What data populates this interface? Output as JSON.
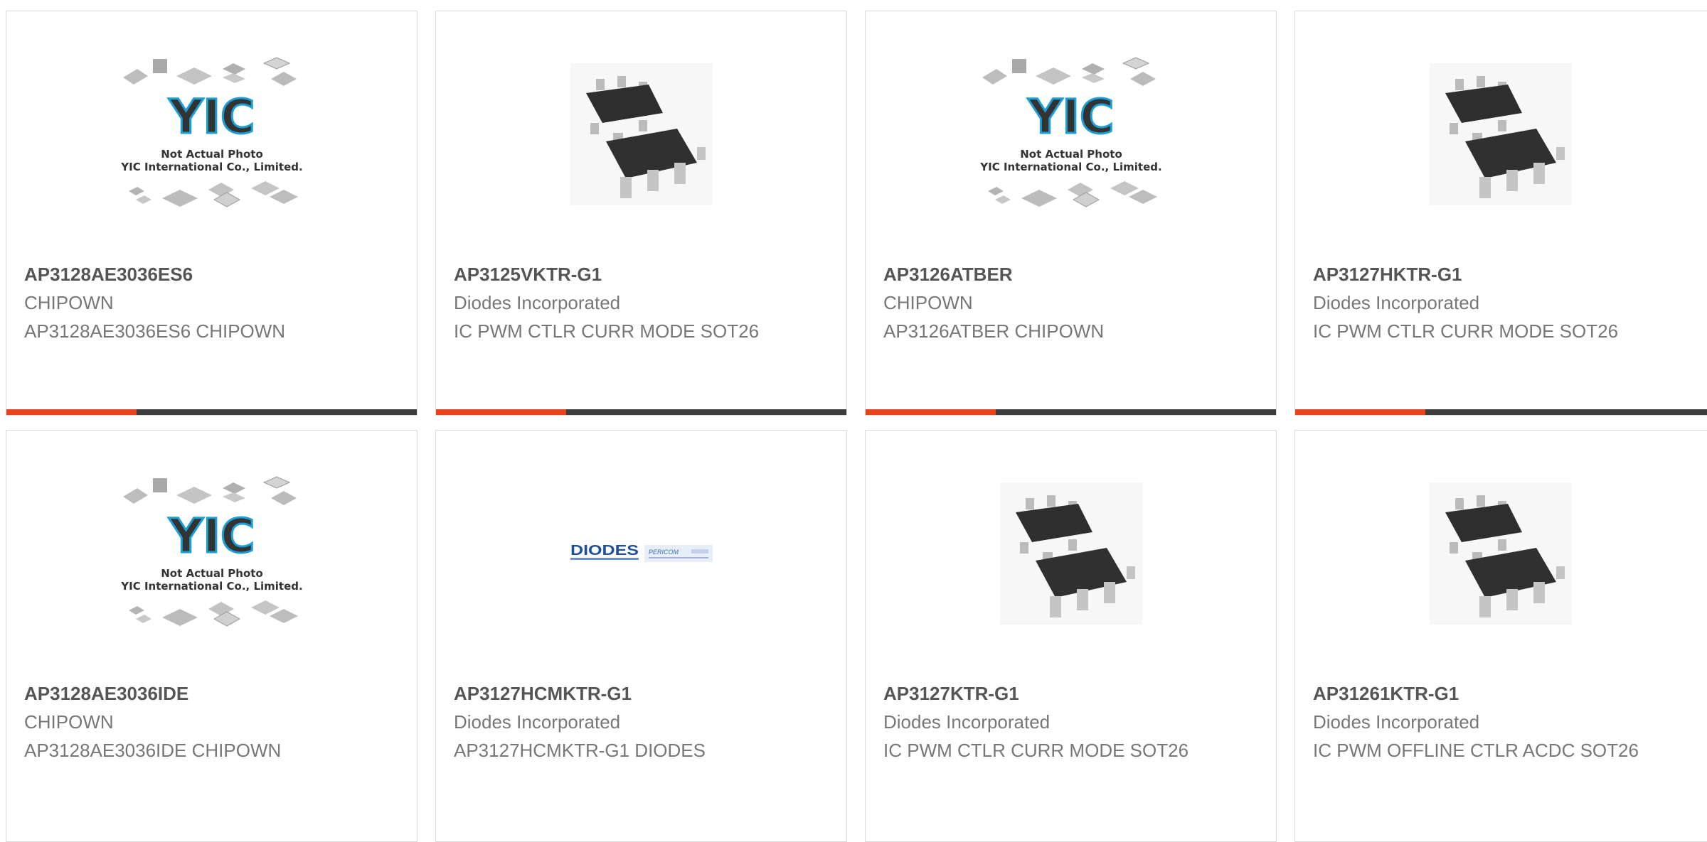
{
  "products": [
    {
      "part_number": "AP3128AE3036ES6",
      "manufacturer": "CHIPOWN",
      "description": "AP3128AE3036ES6 CHIPOWN",
      "image": "yic-placeholder",
      "image_text_1": "Not Actual Photo",
      "image_text_2": "YIC International Co., Limited.",
      "logo_text": "YIC"
    },
    {
      "part_number": "AP3125VKTR-G1",
      "manufacturer": "Diodes Incorporated",
      "description": "IC PWM CTLR CURR MODE SOT26",
      "image": "sot26-chip"
    },
    {
      "part_number": "AP3126ATBER",
      "manufacturer": "CHIPOWN",
      "description": "AP3126ATBER CHIPOWN",
      "image": "yic-placeholder",
      "image_text_1": "Not Actual Photo",
      "image_text_2": "YIC International Co., Limited.",
      "logo_text": "YIC"
    },
    {
      "part_number": "AP3127HKTR-G1",
      "manufacturer": "Diodes Incorporated",
      "description": "IC PWM CTLR CURR MODE SOT26",
      "image": "sot26-chip"
    },
    {
      "part_number": "AP3128AE3036IDE",
      "manufacturer": "CHIPOWN",
      "description": "AP3128AE3036IDE CHIPOWN",
      "image": "yic-placeholder",
      "image_text_1": "Not Actual Photo",
      "image_text_2": "YIC International Co., Limited.",
      "logo_text": "YIC"
    },
    {
      "part_number": "AP3127HCMKTR-G1",
      "manufacturer": "Diodes Incorporated",
      "description": "AP3127HCMKTR-G1 DIODES",
      "image": "diodes-pericom-logo",
      "logo_text_1": "DIODES",
      "logo_text_2": "PERICOM"
    },
    {
      "part_number": "AP3127KTR-G1",
      "manufacturer": "Diodes Incorporated",
      "description": "IC PWM CTLR CURR MODE SOT26",
      "image": "sot26-chip"
    },
    {
      "part_number": "AP31261KTR-G1",
      "manufacturer": "Diodes Incorporated",
      "description": "IC PWM OFFLINE CTLR ACDC SOT26",
      "image": "sot26-chip"
    }
  ],
  "colors": {
    "accent": "#e8431a",
    "bar": "#3b3b3b",
    "yic_blue": "#1a9fd6",
    "diodes_blue": "#1f4f9c"
  }
}
